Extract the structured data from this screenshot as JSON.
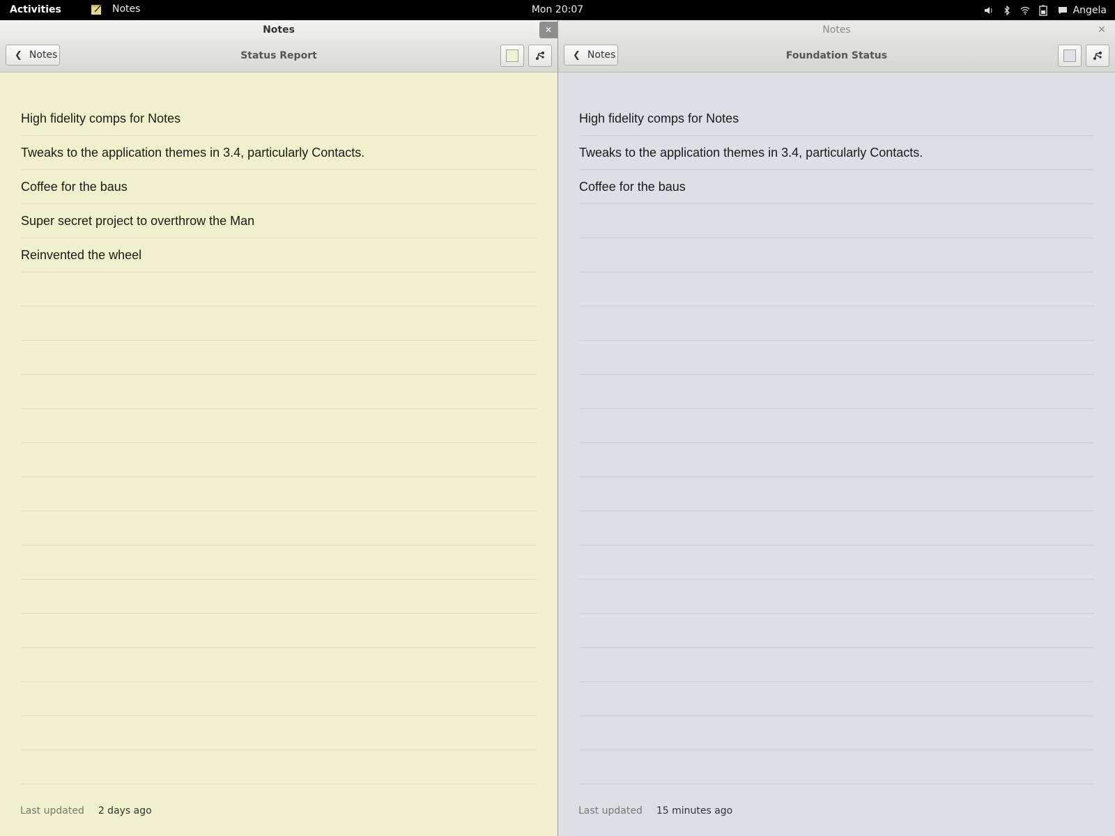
{
  "topbar": {
    "activities": "Activities",
    "app_name": "Notes",
    "clock": "Mon 20:07",
    "user": "Angela"
  },
  "left": {
    "window_title": "Notes",
    "back_label": "Notes",
    "note_title": "Status Report",
    "color": "#eef1cb",
    "lines": [
      "High fidelity comps for Notes",
      "Tweaks to the application themes in 3.4, particularly Contacts.",
      "Coffee for the baus",
      "Super secret project to overthrow the Man",
      "Reinvented the wheel"
    ],
    "footer_label": "Last updated",
    "footer_value": "2 days ago"
  },
  "right": {
    "window_title": "Notes",
    "back_label": "Notes",
    "note_title": "Foundation Status",
    "color": "#dcdfe3",
    "lines": [
      "High fidelity comps for Notes",
      "Tweaks to the application themes in 3.4, particularly Contacts.",
      "Coffee for the baus"
    ],
    "footer_label": "Last updated",
    "footer_value": "15 minutes ago"
  }
}
